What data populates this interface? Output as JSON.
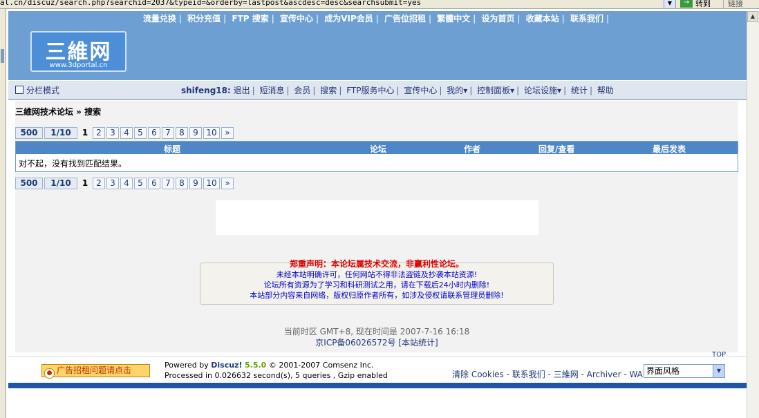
{
  "browser": {
    "url": "al.cn/discuz/search.php?searchid=2037&typeid=&orderby=lastpost&ascdesc=desc&searchsubmit=yes",
    "go_label": "转到",
    "links_label": "链接"
  },
  "header": {
    "top_nav": [
      "流量兑换",
      "积分充值",
      "FTP 搜索",
      "宣传中心",
      "成为VIP会员",
      "广告位招租",
      "繁體中文",
      "设为首页",
      "收藏本站",
      "联系我们"
    ],
    "logo_title": "三維网",
    "logo_url": "www.3dportal.cn"
  },
  "navbar": {
    "view_mode": "分栏模式",
    "username": "shifeng18:",
    "items": [
      "退出",
      "短消息",
      "会员",
      "搜索",
      "FTP服务中心",
      "宣传中心",
      "我的▾",
      "控制面板▾",
      "论坛设施▾",
      "统计",
      "帮助"
    ]
  },
  "breadcrumb": "三維网技术论坛 » 搜索",
  "pager": {
    "total": "500",
    "page_of": "1/10",
    "current": "1",
    "pages": [
      "2",
      "3",
      "4",
      "5",
      "6",
      "7",
      "8",
      "9",
      "10"
    ],
    "next": "»"
  },
  "table": {
    "headers": [
      "标题",
      "论坛",
      "作者",
      "回复/查看",
      "最后发表"
    ],
    "empty_message": "对不起，没有找到匹配结果。"
  },
  "notice": {
    "heading": "郑重声明：本论坛属技术交流，非赢利性论坛。",
    "lines": [
      "未经本站明确许可，任何网站不得非法盗链及抄袭本站资源!",
      "论坛所有资源为了学习和科研测试之用，请在下载后24小时内删除!",
      "本站部分内容来自网络，版权归原作者所有，如涉及侵权请联系管理员删除!"
    ]
  },
  "time_line": "当前时区 GMT+8, 现在时间是 2007-7-16 16:18",
  "icp": "京ICP备06026572号 [本站统计]",
  "top_link": "TOP",
  "footer": {
    "ad_button": "广告招租问题请点击",
    "powered_by": "Powered by",
    "discuz": "Discuz!",
    "version": "5.5.0",
    "copyright": "© 2001-2007 Comsenz Inc.",
    "processed": "Processed in 0.026632 second(s), 5 queries , Gzip enabled",
    "links": "清除 Cookies - 联系我们 - 三維网 - Archiver - WAP",
    "style_select": "界面风格"
  },
  "colors": {
    "header_bg": "#6e9fd2",
    "table_header_bg": "#4e86c7",
    "notice_heading": "#e00000",
    "notice_text": "#0000cc",
    "footer_bar": "#1f55a7"
  }
}
